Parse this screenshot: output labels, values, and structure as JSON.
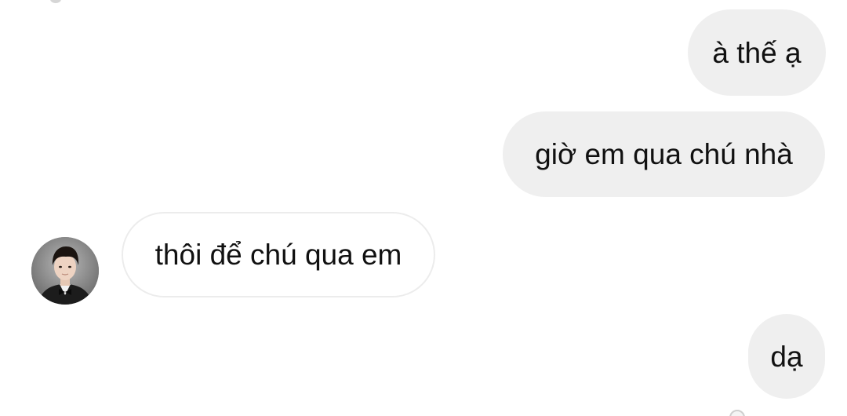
{
  "messages": [
    {
      "direction": "sent",
      "text": "à thế ạ"
    },
    {
      "direction": "sent",
      "text": "giờ em qua chú nhà"
    },
    {
      "direction": "received",
      "text": "thôi để chú qua em"
    },
    {
      "direction": "sent",
      "text": "dạ"
    }
  ],
  "contact": {
    "avatar_icon": "profile-photo-icon"
  },
  "colors": {
    "sent_bubble": "#efefef",
    "received_bubble_border": "#ececec",
    "background": "#ffffff",
    "text": "#111111"
  }
}
